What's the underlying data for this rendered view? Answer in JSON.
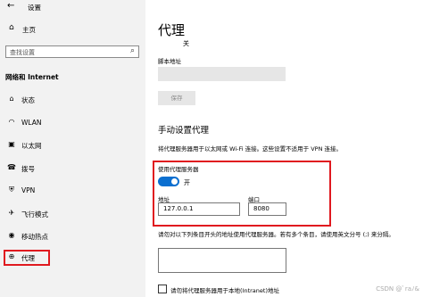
{
  "app": {
    "title": "设置",
    "back_icon": "back-arrow-icon"
  },
  "sidebar": {
    "home_label": "主页",
    "search_placeholder": "查找设置",
    "section_title": "网络和 Internet",
    "items": [
      {
        "label": "状态",
        "icon": "home-network-icon",
        "glyph": "⌂"
      },
      {
        "label": "WLAN",
        "icon": "wifi-icon",
        "glyph": "◠"
      },
      {
        "label": "以太网",
        "icon": "ethernet-icon",
        "glyph": "▣"
      },
      {
        "label": "拨号",
        "icon": "dialup-icon",
        "glyph": "☎"
      },
      {
        "label": "VPN",
        "icon": "vpn-icon",
        "glyph": "⛨"
      },
      {
        "label": "飞行模式",
        "icon": "airplane-icon",
        "glyph": "✈"
      },
      {
        "label": "移动热点",
        "icon": "hotspot-icon",
        "glyph": "◉"
      },
      {
        "label": "代理",
        "icon": "proxy-icon",
        "glyph": "⊕"
      }
    ],
    "active_index": 7
  },
  "main": {
    "title": "代理",
    "auto_toggle_state": "关",
    "script_address_label": "脚本地址",
    "script_address_value": "",
    "save_label": "保存",
    "manual_title": "手动设置代理",
    "manual_desc": "将代理服务器用于以太网或 Wi-Fi 连接。这些设置不适用于 VPN 连接。",
    "use_proxy_label": "使用代理服务器",
    "use_proxy_state": "开",
    "address_label": "地址",
    "address_value": "127.0.0.1",
    "port_label": "端口",
    "port_value": "8080",
    "exempt_desc": "请勿对以下列条目开头的地址使用代理服务器。若有多个条目，请使用英文分号 (;) 来分隔。",
    "exempt_value": "",
    "local_bypass_label": "请勿将代理服务器用于本地(Intranet)地址"
  },
  "watermark": "CSDN @ﾞraﾉ&",
  "colors": {
    "accent": "#0b6fd0",
    "highlight": "#e0191f",
    "sidebar_bg": "#f2f2f2"
  }
}
